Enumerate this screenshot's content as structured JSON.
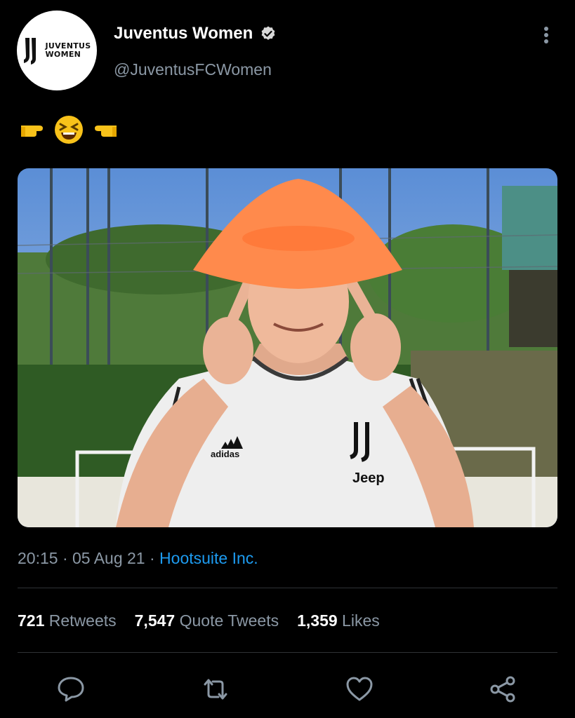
{
  "tweet": {
    "author_name": "Juventus Women",
    "author_handle": "@JuventusFCWomen",
    "avatar_text_line1": "JUVENTUS",
    "avatar_text_line2": "WOMEN",
    "text_emojis": [
      "point-right-emoji",
      "laughing-face-emoji",
      "point-left-emoji"
    ],
    "timestamp": "20:15 · 05 Aug 21 · ",
    "source": "Hootsuite Inc.",
    "stats": {
      "retweets_count": "721",
      "retweets_label": "Retweets",
      "quotes_count": "7,547",
      "quotes_label": "Quote Tweets",
      "likes_count": "1,359",
      "likes_label": "Likes"
    },
    "photo_text": {
      "brand": "adidas",
      "sponsor": "Jeep"
    }
  },
  "colors": {
    "background": "#000000",
    "secondary_text": "#8b98a5",
    "link": "#1d9bf0",
    "divider": "#2f3336"
  }
}
